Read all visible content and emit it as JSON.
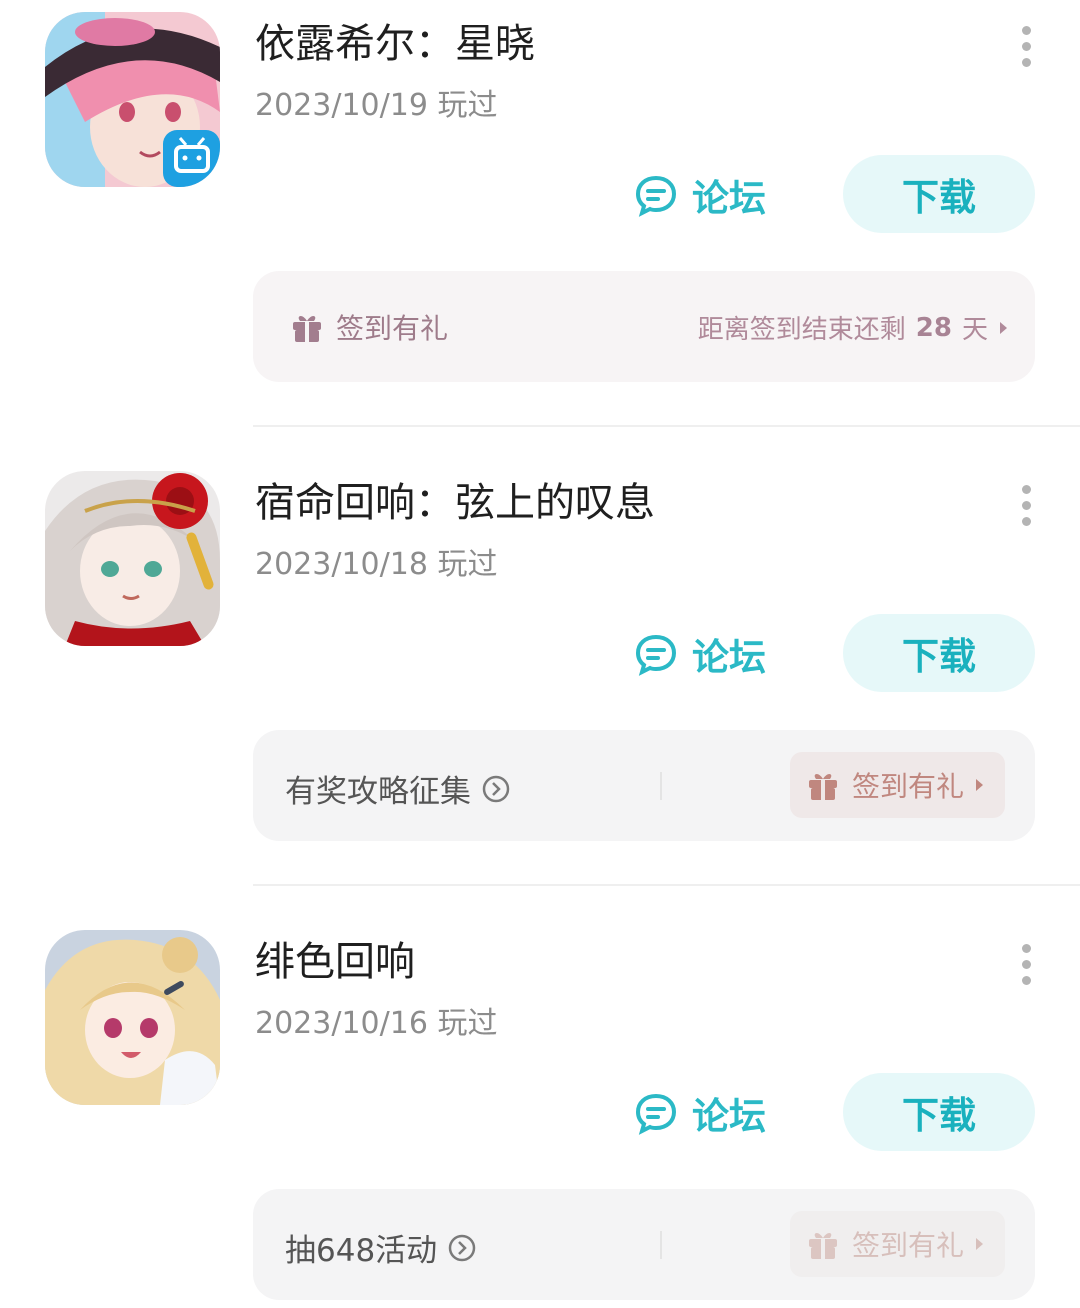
{
  "colors": {
    "accent_teal": "#2bb9c6",
    "download_bg": "#e6f8f9",
    "checkin_text": "#9e7b8a",
    "gift_pill_text": "#c0877f"
  },
  "games": [
    {
      "title": "依露希尔：星晓",
      "played": "2023/10/19 玩过",
      "icon": "game-icon-pink-hair-character-with-bilibili-badge",
      "forum_label": "论坛",
      "download_label": "下载",
      "bar_type": "checkin",
      "checkin_label": "签到有礼",
      "remaining_prefix": "距离签到结束还剩",
      "remaining_days": "28",
      "remaining_suffix": "天"
    },
    {
      "title": "宿命回响：弦上的叹息",
      "played": "2023/10/18 玩过",
      "icon": "game-icon-silver-hair-character-with-red-rose",
      "forum_label": "论坛",
      "download_label": "下载",
      "bar_type": "promo",
      "promo_label": "有奖攻略征集",
      "checkin_label": "签到有礼"
    },
    {
      "title": "绯色回响",
      "played": "2023/10/16 玩过",
      "icon": "game-icon-blonde-character-waving",
      "forum_label": "论坛",
      "download_label": "下载",
      "bar_type": "promo",
      "promo_label": "抽648活动",
      "checkin_label": "签到有礼"
    }
  ]
}
